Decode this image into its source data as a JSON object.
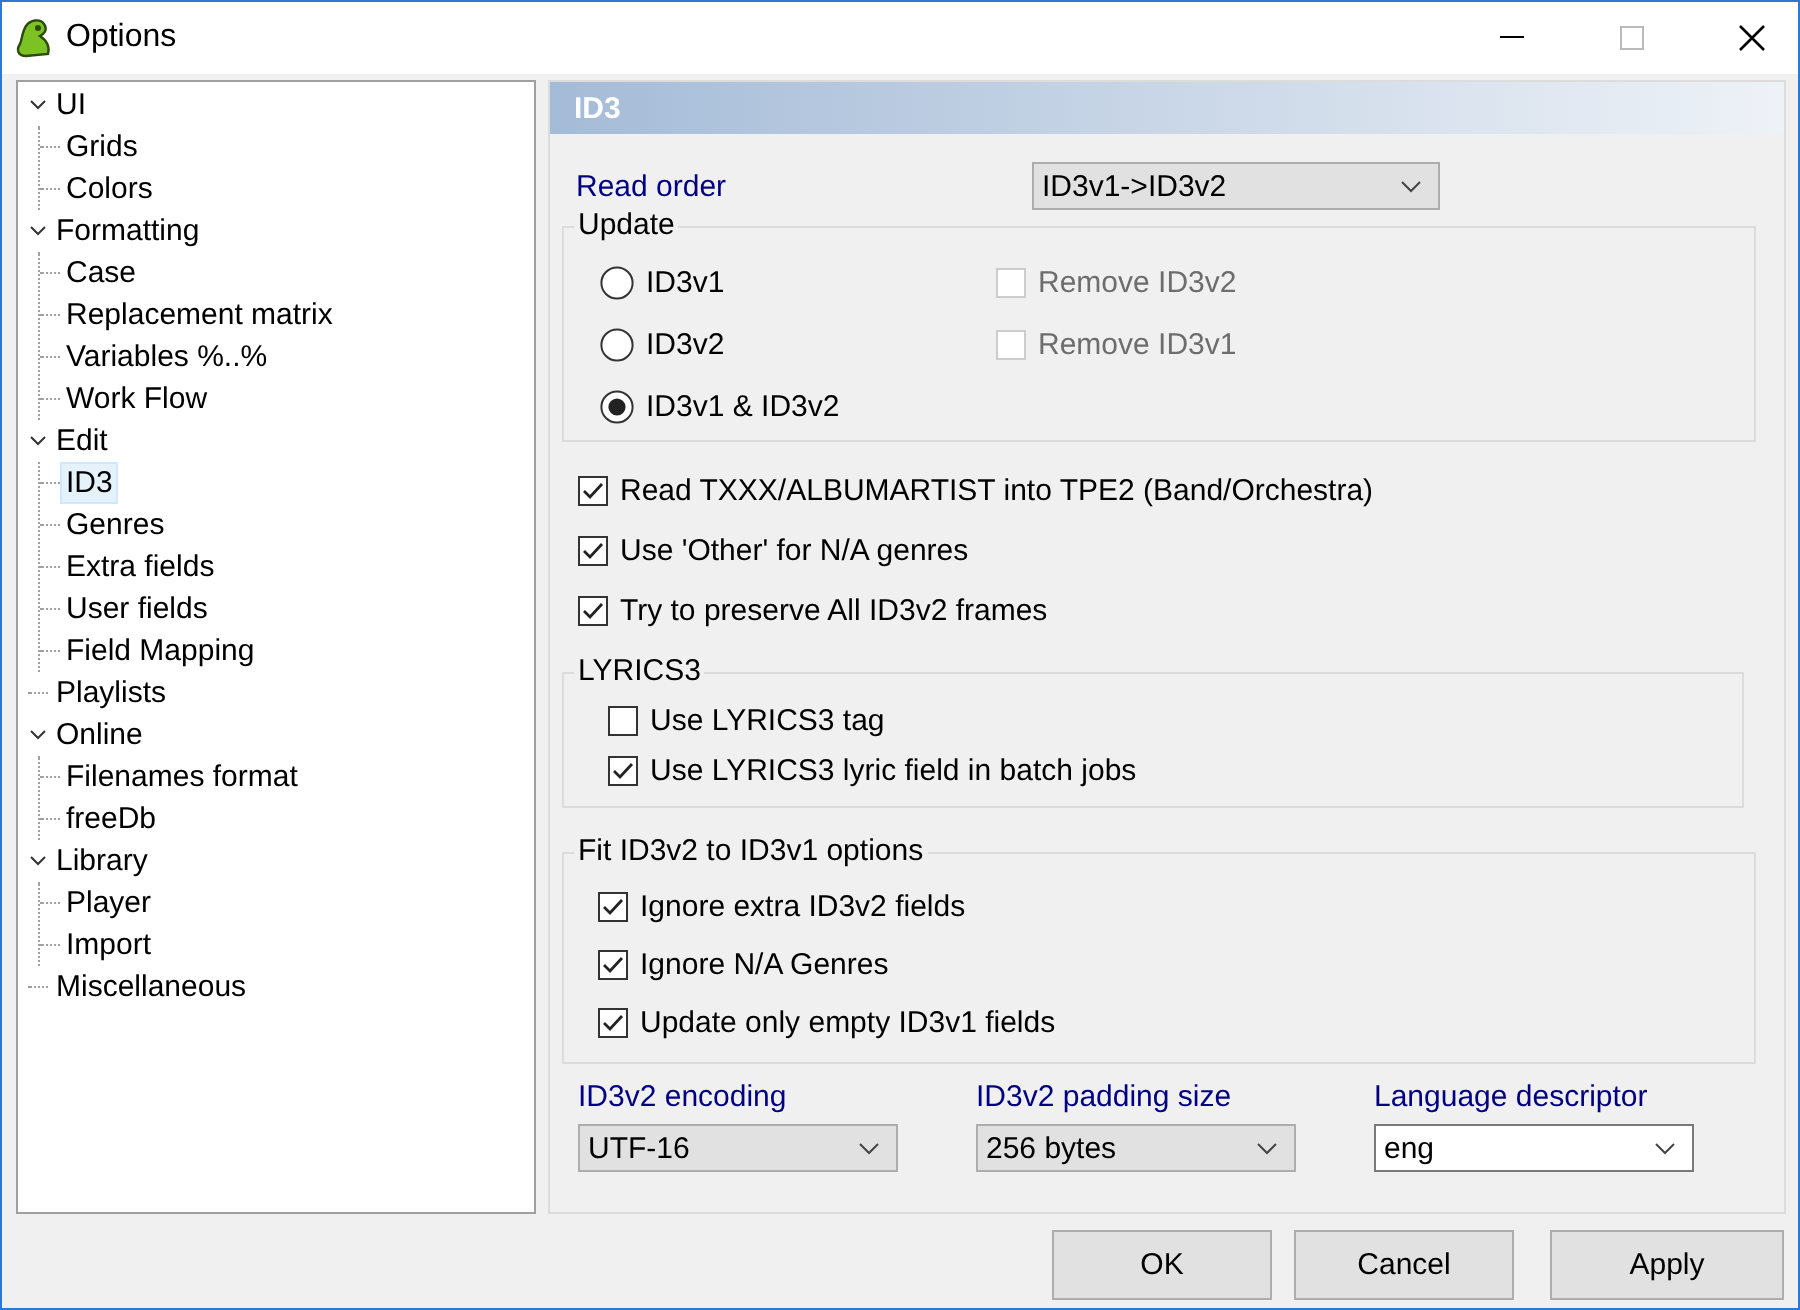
{
  "window": {
    "title": "Options"
  },
  "tree": [
    {
      "label": "UI",
      "expanded": true,
      "selected": false,
      "children": [
        {
          "label": "Grids",
          "selected": false
        },
        {
          "label": "Colors",
          "selected": false
        }
      ]
    },
    {
      "label": "Formatting",
      "expanded": true,
      "selected": false,
      "children": [
        {
          "label": "Case",
          "selected": false
        },
        {
          "label": "Replacement matrix",
          "selected": false
        },
        {
          "label": "Variables %..%",
          "selected": false
        },
        {
          "label": "Work Flow",
          "selected": false
        }
      ]
    },
    {
      "label": "Edit",
      "expanded": true,
      "selected": false,
      "children": [
        {
          "label": "ID3",
          "selected": true
        },
        {
          "label": "Genres",
          "selected": false
        },
        {
          "label": "Extra fields",
          "selected": false
        },
        {
          "label": "User fields",
          "selected": false
        },
        {
          "label": "Field Mapping",
          "selected": false
        }
      ]
    },
    {
      "label": "Playlists",
      "selected": false
    },
    {
      "label": "Online",
      "expanded": true,
      "selected": false,
      "children": [
        {
          "label": "Filenames format",
          "selected": false
        },
        {
          "label": "freeDb",
          "selected": false
        }
      ]
    },
    {
      "label": "Library",
      "expanded": true,
      "selected": false,
      "children": [
        {
          "label": "Player",
          "selected": false
        },
        {
          "label": "Import",
          "selected": false
        }
      ]
    },
    {
      "label": "Miscellaneous",
      "selected": false
    }
  ],
  "panel": {
    "title": "ID3",
    "read_order": {
      "label": "Read order",
      "value": "ID3v1->ID3v2"
    },
    "update": {
      "title": "Update",
      "radios": [
        {
          "label": "ID3v1",
          "selected": false
        },
        {
          "label": "ID3v2",
          "selected": false
        },
        {
          "label": "ID3v1 & ID3v2",
          "selected": true
        }
      ],
      "checks": [
        {
          "label": "Remove ID3v2",
          "checked": false,
          "disabled": true
        },
        {
          "label": "Remove ID3v1",
          "checked": false,
          "disabled": true
        }
      ]
    },
    "options": [
      {
        "label": "Read TXXX/ALBUMARTIST into TPE2 (Band/Orchestra)",
        "checked": true
      },
      {
        "label": "Use 'Other' for N/A genres",
        "checked": true
      },
      {
        "label": "Try to preserve All ID3v2 frames",
        "checked": true
      }
    ],
    "lyrics3": {
      "title": "LYRICS3",
      "checks": [
        {
          "label": "Use LYRICS3 tag",
          "checked": false
        },
        {
          "label": "Use LYRICS3 lyric field in batch jobs",
          "checked": true
        }
      ]
    },
    "fit": {
      "title": "Fit ID3v2 to ID3v1 options",
      "checks": [
        {
          "label": "Ignore extra ID3v2 fields",
          "checked": true
        },
        {
          "label": "Ignore N/A Genres",
          "checked": true
        },
        {
          "label": "Update only empty ID3v1 fields",
          "checked": true
        }
      ]
    },
    "selects": [
      {
        "label": "ID3v2 encoding",
        "value": "UTF-16",
        "editable": false
      },
      {
        "label": "ID3v2 padding size",
        "value": "256 bytes",
        "editable": false
      },
      {
        "label": "Language descriptor",
        "value": "eng",
        "editable": true
      }
    ]
  },
  "buttons": [
    "OK",
    "Cancel",
    "Apply"
  ]
}
